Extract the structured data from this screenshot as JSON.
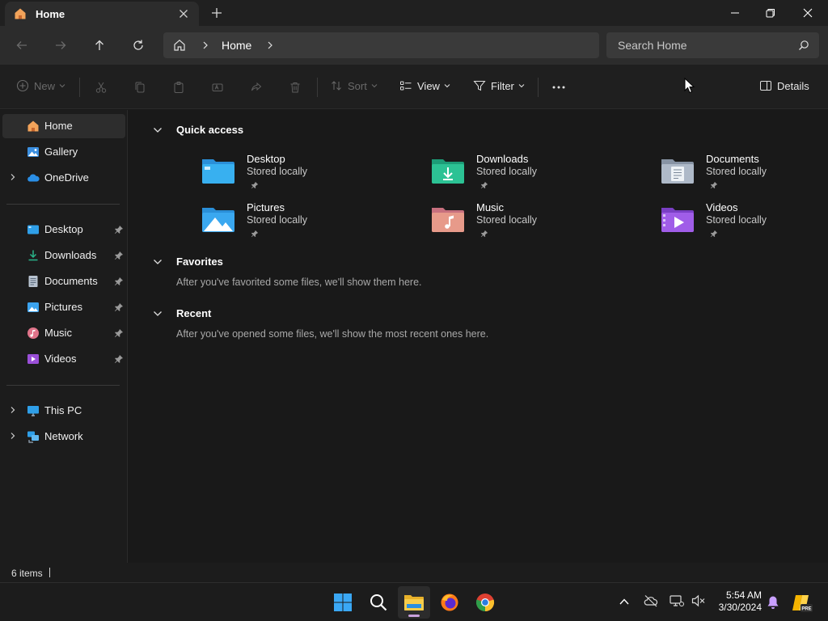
{
  "window": {
    "tab_title": "Home"
  },
  "address": {
    "crumb": "Home",
    "search_placeholder": "Search Home"
  },
  "toolbar": {
    "new_label": "New",
    "sort_label": "Sort",
    "view_label": "View",
    "filter_label": "Filter",
    "details_label": "Details"
  },
  "sidebar": {
    "top": [
      {
        "label": "Home"
      },
      {
        "label": "Gallery"
      },
      {
        "label": "OneDrive"
      }
    ],
    "pinned": [
      {
        "label": "Desktop"
      },
      {
        "label": "Downloads"
      },
      {
        "label": "Documents"
      },
      {
        "label": "Pictures"
      },
      {
        "label": "Music"
      },
      {
        "label": "Videos"
      }
    ],
    "bottom": [
      {
        "label": "This PC"
      },
      {
        "label": "Network"
      }
    ]
  },
  "main": {
    "quick_access": {
      "title": "Quick access",
      "items": [
        {
          "name": "Desktop",
          "sub": "Stored locally",
          "icon": "desktop-folder-icon"
        },
        {
          "name": "Downloads",
          "sub": "Stored locally",
          "icon": "downloads-folder-icon"
        },
        {
          "name": "Documents",
          "sub": "Stored locally",
          "icon": "documents-folder-icon"
        },
        {
          "name": "Pictures",
          "sub": "Stored locally",
          "icon": "pictures-folder-icon"
        },
        {
          "name": "Music",
          "sub": "Stored locally",
          "icon": "music-folder-icon"
        },
        {
          "name": "Videos",
          "sub": "Stored locally",
          "icon": "videos-folder-icon"
        }
      ]
    },
    "favorites": {
      "title": "Favorites",
      "message": "After you've favorited some files, we'll show them here."
    },
    "recent": {
      "title": "Recent",
      "message": "After you've opened some files, we'll show the most recent ones here."
    }
  },
  "status": {
    "count": "6 items"
  },
  "taskbar": {
    "time": "5:54 AM",
    "date": "3/30/2024",
    "copilot_badge": "PRE"
  }
}
